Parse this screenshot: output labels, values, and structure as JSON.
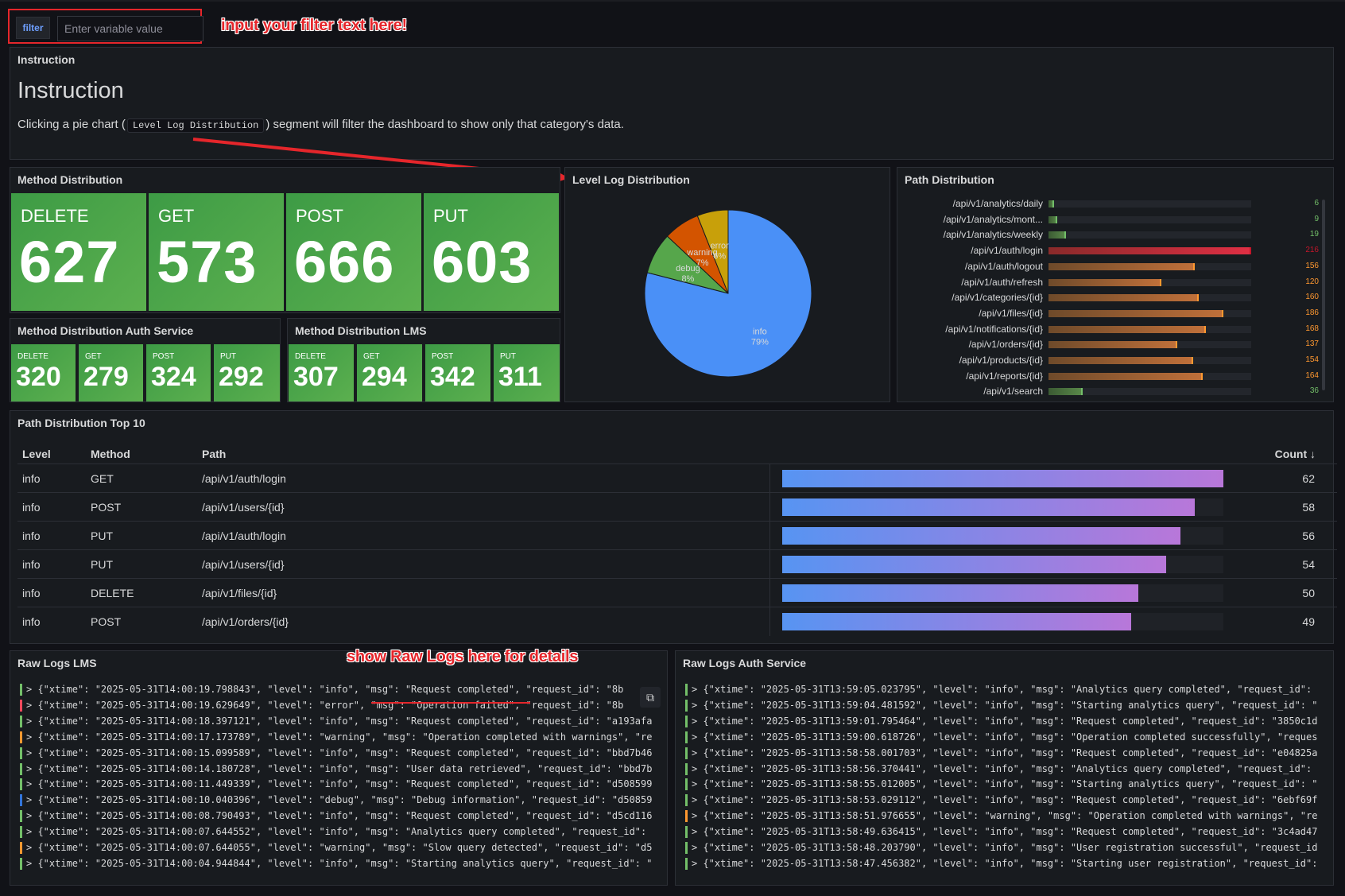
{
  "filter": {
    "label": "filter",
    "placeholder": "Enter variable value"
  },
  "annotations": {
    "filter_hint": "input your filter text here!",
    "logs_hint": "show Raw Logs here for details"
  },
  "instruction": {
    "panel_title": "Instruction",
    "heading": "Instruction",
    "text_before": "Clicking a pie chart (",
    "code": "Level Log Distribution",
    "text_after": ") segment will filter the dashboard to show only that category's data."
  },
  "method_distribution": {
    "title": "Method Distribution",
    "stats": [
      {
        "label": "DELETE",
        "value": "627"
      },
      {
        "label": "GET",
        "value": "573"
      },
      {
        "label": "POST",
        "value": "666"
      },
      {
        "label": "PUT",
        "value": "603"
      }
    ]
  },
  "method_auth": {
    "title": "Method Distribution Auth Service",
    "stats": [
      {
        "label": "DELETE",
        "value": "320"
      },
      {
        "label": "GET",
        "value": "279"
      },
      {
        "label": "POST",
        "value": "324"
      },
      {
        "label": "PUT",
        "value": "292"
      }
    ]
  },
  "method_lms": {
    "title": "Method Distribution LMS",
    "stats": [
      {
        "label": "DELETE",
        "value": "307"
      },
      {
        "label": "GET",
        "value": "294"
      },
      {
        "label": "POST",
        "value": "342"
      },
      {
        "label": "PUT",
        "value": "311"
      }
    ]
  },
  "level_log": {
    "title": "Level Log Distribution"
  },
  "chart_data": [
    {
      "type": "pie",
      "title": "Level Log Distribution",
      "categories": [
        "info",
        "debug",
        "warning",
        "error"
      ],
      "values": [
        79,
        8,
        7,
        6
      ],
      "labels": [
        "79%",
        "8%",
        "7%",
        "6%"
      ],
      "colors": [
        "#4a90f7",
        "#56a64b",
        "#d35400",
        "#c8a00a"
      ]
    },
    {
      "type": "bar",
      "title": "Path Distribution",
      "categories": [
        "/api/v1/analytics/daily",
        "/api/v1/analytics/mont...",
        "/api/v1/analytics/weekly",
        "/api/v1/auth/login",
        "/api/v1/auth/logout",
        "/api/v1/auth/refresh",
        "/api/v1/categories/{id}",
        "/api/v1/files/{id}",
        "/api/v1/notifications/{id}",
        "/api/v1/orders/{id}",
        "/api/v1/products/{id}",
        "/api/v1/reports/{id}",
        "/api/v1/search"
      ],
      "values": [
        6,
        9,
        19,
        216,
        156,
        120,
        160,
        186,
        168,
        137,
        154,
        164,
        36
      ],
      "xlim": [
        0,
        216
      ]
    },
    {
      "type": "table",
      "title": "Path Distribution Top 10",
      "columns": [
        "Level",
        "Method",
        "Path",
        "Count"
      ],
      "rows": [
        {
          "level": "info",
          "method": "GET",
          "path": "/api/v1/auth/login",
          "count": 62
        },
        {
          "level": "info",
          "method": "POST",
          "path": "/api/v1/users/{id}",
          "count": 58
        },
        {
          "level": "info",
          "method": "PUT",
          "path": "/api/v1/auth/login",
          "count": 56
        },
        {
          "level": "info",
          "method": "PUT",
          "path": "/api/v1/users/{id}",
          "count": 54
        },
        {
          "level": "info",
          "method": "DELETE",
          "path": "/api/v1/files/{id}",
          "count": 50
        },
        {
          "level": "info",
          "method": "POST",
          "path": "/api/v1/orders/{id}",
          "count": 49
        }
      ],
      "xlim": [
        0,
        62
      ]
    }
  ],
  "path_distribution": {
    "title": "Path Distribution"
  },
  "top10": {
    "title": "Path Distribution Top 10",
    "headers": {
      "level": "Level",
      "method": "Method",
      "path": "Path",
      "count": "Count ↓"
    }
  },
  "raw_logs_lms": {
    "title": "Raw Logs LMS",
    "lines": [
      {
        "level": "info",
        "text": "> {\"xtime\": \"2025-05-31T14:00:19.798843\", \"level\": \"info\", \"msg\": \"Request completed\", \"request_id\": \"8b"
      },
      {
        "level": "error",
        "text": "> {\"xtime\": \"2025-05-31T14:00:19.629649\", \"level\": \"error\", \"msg\": \"Operation failed\", \"request_id\": \"8b"
      },
      {
        "level": "info",
        "text": "> {\"xtime\": \"2025-05-31T14:00:18.397121\", \"level\": \"info\", \"msg\": \"Request completed\", \"request_id\": \"a193afa"
      },
      {
        "level": "warning",
        "text": "> {\"xtime\": \"2025-05-31T14:00:17.173789\", \"level\": \"warning\", \"msg\": \"Operation completed with warnings\", \"re"
      },
      {
        "level": "info",
        "text": "> {\"xtime\": \"2025-05-31T14:00:15.099589\", \"level\": \"info\", \"msg\": \"Request completed\", \"request_id\": \"bbd7b46"
      },
      {
        "level": "info",
        "text": "> {\"xtime\": \"2025-05-31T14:00:14.180728\", \"level\": \"info\", \"msg\": \"User data retrieved\", \"request_id\": \"bbd7b"
      },
      {
        "level": "info",
        "text": "> {\"xtime\": \"2025-05-31T14:00:11.449339\", \"level\": \"info\", \"msg\": \"Request completed\", \"request_id\": \"d508599"
      },
      {
        "level": "debug",
        "text": "> {\"xtime\": \"2025-05-31T14:00:10.040396\", \"level\": \"debug\", \"msg\": \"Debug information\", \"request_id\": \"d50859"
      },
      {
        "level": "info",
        "text": "> {\"xtime\": \"2025-05-31T14:00:08.790493\", \"level\": \"info\", \"msg\": \"Request completed\", \"request_id\": \"d5cd116"
      },
      {
        "level": "info",
        "text": "> {\"xtime\": \"2025-05-31T14:00:07.644552\", \"level\": \"info\", \"msg\": \"Analytics query completed\", \"request_id\":"
      },
      {
        "level": "warning",
        "text": "> {\"xtime\": \"2025-05-31T14:00:07.644055\", \"level\": \"warning\", \"msg\": \"Slow query detected\", \"request_id\": \"d5"
      },
      {
        "level": "info",
        "text": "> {\"xtime\": \"2025-05-31T14:00:04.944844\", \"level\": \"info\", \"msg\": \"Starting analytics query\", \"request_id\": \""
      }
    ]
  },
  "raw_logs_auth": {
    "title": "Raw Logs Auth Service",
    "lines": [
      {
        "level": "info",
        "text": "> {\"xtime\": \"2025-05-31T13:59:05.023795\", \"level\": \"info\", \"msg\": \"Analytics query completed\", \"request_id\":"
      },
      {
        "level": "info",
        "text": "> {\"xtime\": \"2025-05-31T13:59:04.481592\", \"level\": \"info\", \"msg\": \"Starting analytics query\", \"request_id\": \""
      },
      {
        "level": "info",
        "text": "> {\"xtime\": \"2025-05-31T13:59:01.795464\", \"level\": \"info\", \"msg\": \"Request completed\", \"request_id\": \"3850c1d"
      },
      {
        "level": "info",
        "text": "> {\"xtime\": \"2025-05-31T13:59:00.618726\", \"level\": \"info\", \"msg\": \"Operation completed successfully\", \"reques"
      },
      {
        "level": "info",
        "text": "> {\"xtime\": \"2025-05-31T13:58:58.001703\", \"level\": \"info\", \"msg\": \"Request completed\", \"request_id\": \"e04825a"
      },
      {
        "level": "info",
        "text": "> {\"xtime\": \"2025-05-31T13:58:56.370441\", \"level\": \"info\", \"msg\": \"Analytics query completed\", \"request_id\":"
      },
      {
        "level": "info",
        "text": "> {\"xtime\": \"2025-05-31T13:58:55.012005\", \"level\": \"info\", \"msg\": \"Starting analytics query\", \"request_id\": \""
      },
      {
        "level": "info",
        "text": "> {\"xtime\": \"2025-05-31T13:58:53.029112\", \"level\": \"info\", \"msg\": \"Request completed\", \"request_id\": \"6ebf69f"
      },
      {
        "level": "warning",
        "text": "> {\"xtime\": \"2025-05-31T13:58:51.976655\", \"level\": \"warning\", \"msg\": \"Operation completed with warnings\", \"re"
      },
      {
        "level": "info",
        "text": "> {\"xtime\": \"2025-05-31T13:58:49.636415\", \"level\": \"info\", \"msg\": \"Request completed\", \"request_id\": \"3c4ad47"
      },
      {
        "level": "info",
        "text": "> {\"xtime\": \"2025-05-31T13:58:48.203790\", \"level\": \"info\", \"msg\": \"User registration successful\", \"request_id"
      },
      {
        "level": "info",
        "text": "> {\"xtime\": \"2025-05-31T13:58:47.456382\", \"level\": \"info\", \"msg\": \"Starting user registration\", \"request_id\":"
      }
    ]
  },
  "level_colors": {
    "info": "#73bf69",
    "error": "#f2495c",
    "warning": "#ff9830",
    "debug": "#3274d9"
  }
}
